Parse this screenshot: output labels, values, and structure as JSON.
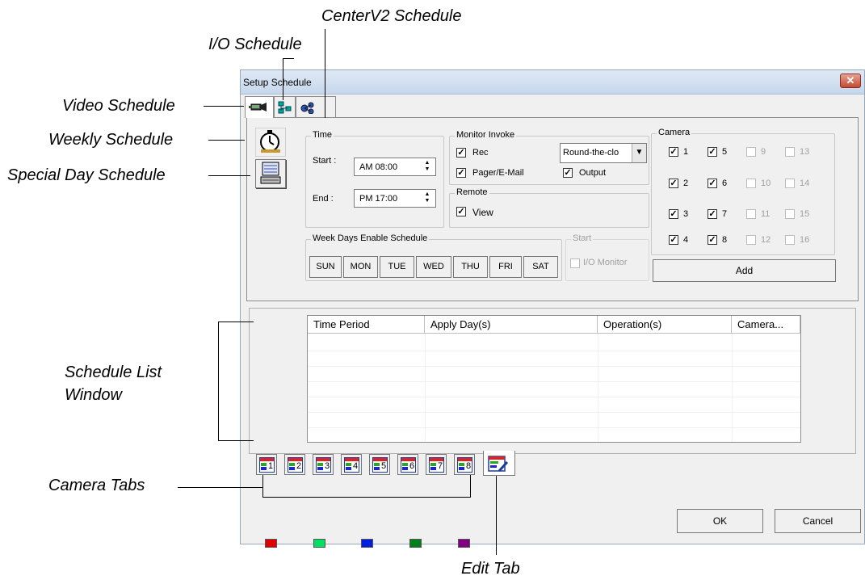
{
  "callouts": {
    "centerv2": "CenterV2 Schedule",
    "io": "I/O Schedule",
    "video": "Video Schedule",
    "weekly": "Weekly Schedule",
    "special": "Special Day Schedule",
    "list_line1": "Schedule List",
    "list_line2": "Window",
    "camera_tabs": "Camera Tabs",
    "edit_tab": "Edit  Tab"
  },
  "window": {
    "title": "Setup Schedule",
    "close_label": "✕"
  },
  "time": {
    "legend": "Time",
    "start_label": "Start :",
    "start_value": "AM 08:00",
    "end_label": "End :",
    "end_value": "PM 17:00"
  },
  "monitor": {
    "legend": "Monitor Invoke",
    "rec": "Rec",
    "pager": "Pager/E-Mail",
    "output": "Output",
    "dropdown_value": "Round-the-clo"
  },
  "remote": {
    "legend": "Remote",
    "view": "View"
  },
  "camera": {
    "legend": "Camera",
    "items": [
      {
        "label": "1",
        "checked": true,
        "enabled": true
      },
      {
        "label": "2",
        "checked": true,
        "enabled": true
      },
      {
        "label": "3",
        "checked": true,
        "enabled": true
      },
      {
        "label": "4",
        "checked": true,
        "enabled": true
      },
      {
        "label": "5",
        "checked": true,
        "enabled": true
      },
      {
        "label": "6",
        "checked": true,
        "enabled": true
      },
      {
        "label": "7",
        "checked": true,
        "enabled": true
      },
      {
        "label": "8",
        "checked": true,
        "enabled": true
      },
      {
        "label": "9",
        "checked": false,
        "enabled": false
      },
      {
        "label": "10",
        "checked": false,
        "enabled": false
      },
      {
        "label": "11",
        "checked": false,
        "enabled": false
      },
      {
        "label": "12",
        "checked": false,
        "enabled": false
      },
      {
        "label": "13",
        "checked": false,
        "enabled": false
      },
      {
        "label": "14",
        "checked": false,
        "enabled": false
      },
      {
        "label": "15",
        "checked": false,
        "enabled": false
      },
      {
        "label": "16",
        "checked": false,
        "enabled": false
      }
    ],
    "add_label": "Add"
  },
  "weekdays": {
    "legend": "Week Days Enable Schedule",
    "days": [
      "SUN",
      "MON",
      "TUE",
      "WED",
      "THU",
      "FRI",
      "SAT"
    ]
  },
  "start_group": {
    "legend": "Start",
    "io_monitor": "I/O Monitor"
  },
  "schedule_list": {
    "columns": [
      "Time Period",
      "Apply Day(s)",
      "Operation(s)",
      "Camera..."
    ]
  },
  "camera_tabs": [
    "1",
    "2",
    "3",
    "4",
    "5",
    "6",
    "7",
    "8"
  ],
  "buttons": {
    "ok": "OK",
    "cancel": "Cancel"
  },
  "swatches": [
    "#e00000",
    "#00e060",
    "#0020e0",
    "#00801a",
    "#800080"
  ]
}
